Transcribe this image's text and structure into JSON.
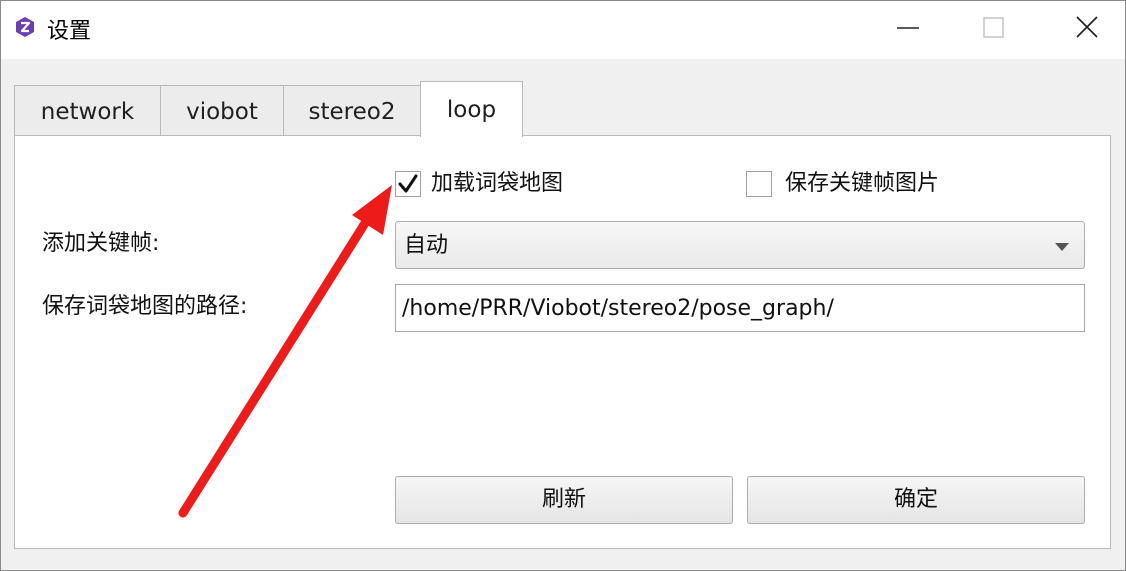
{
  "window": {
    "title": "设置",
    "controls": [
      "minimize",
      "maximize",
      "close"
    ]
  },
  "tabs": [
    {
      "label": "network",
      "active": false
    },
    {
      "label": "viobot",
      "active": false
    },
    {
      "label": "stereo2",
      "active": false
    },
    {
      "label": "loop",
      "active": true
    }
  ],
  "loop": {
    "load_bow_map": {
      "label": "加载词袋地图",
      "checked": true
    },
    "save_keyframe_images": {
      "label": "保存关键帧图片",
      "checked": false
    },
    "add_keyframe": {
      "label": "添加关键帧:",
      "value": "自动"
    },
    "bow_map_path": {
      "label": "保存词袋地图的路径:",
      "value": "/home/PRR/Viobot/stereo2/pose_graph/"
    },
    "refresh_label": "刷新",
    "confirm_label": "确定"
  },
  "annotation": {
    "color": "#ee1b1b"
  },
  "colors": {
    "accent": "#6a3fb5",
    "text": "#111111"
  }
}
